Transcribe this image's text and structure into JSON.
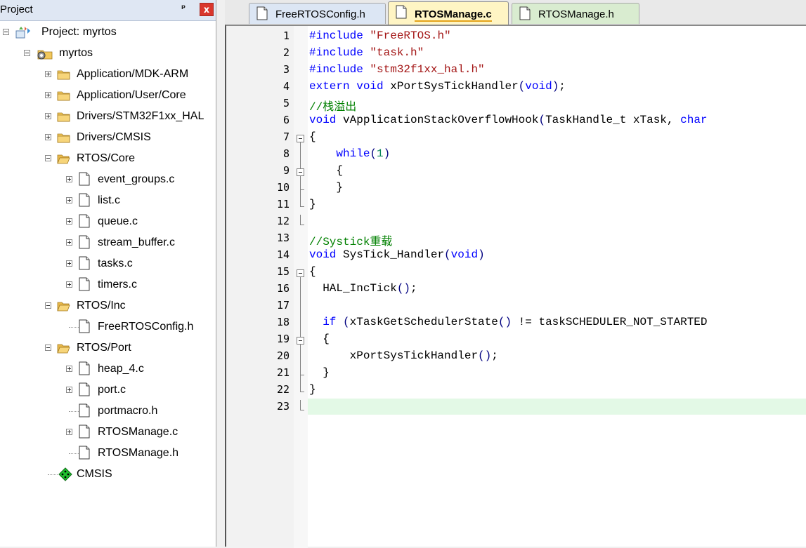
{
  "panel": {
    "title": "Project",
    "pin": "ᵖ",
    "close": "x"
  },
  "tree": [
    {
      "label": "Project: myrtos",
      "type": "project",
      "depth": 0,
      "expander": "minus"
    },
    {
      "label": "myrtos",
      "type": "target",
      "depth": 1,
      "expander": "minus"
    },
    {
      "label": "Application/MDK-ARM",
      "type": "folder",
      "depth": 2,
      "expander": "plus"
    },
    {
      "label": "Application/User/Core",
      "type": "folder",
      "depth": 2,
      "expander": "plus"
    },
    {
      "label": "Drivers/STM32F1xx_HAL",
      "type": "folder",
      "depth": 2,
      "expander": "plus"
    },
    {
      "label": "Drivers/CMSIS",
      "type": "folder",
      "depth": 2,
      "expander": "plus"
    },
    {
      "label": "RTOS/Core",
      "type": "folder-open",
      "depth": 2,
      "expander": "minus"
    },
    {
      "label": "event_groups.c",
      "type": "file",
      "depth": 3,
      "expander": "plus"
    },
    {
      "label": "list.c",
      "type": "file",
      "depth": 3,
      "expander": "plus"
    },
    {
      "label": "queue.c",
      "type": "file",
      "depth": 3,
      "expander": "plus"
    },
    {
      "label": "stream_buffer.c",
      "type": "file",
      "depth": 3,
      "expander": "plus"
    },
    {
      "label": "tasks.c",
      "type": "file",
      "depth": 3,
      "expander": "plus"
    },
    {
      "label": "timers.c",
      "type": "file",
      "depth": 3,
      "expander": "plus"
    },
    {
      "label": "RTOS/Inc",
      "type": "folder-open",
      "depth": 2,
      "expander": "minus"
    },
    {
      "label": "FreeRTOSConfig.h",
      "type": "file",
      "depth": 3,
      "expander": "none"
    },
    {
      "label": "RTOS/Port",
      "type": "folder-open",
      "depth": 2,
      "expander": "minus"
    },
    {
      "label": "heap_4.c",
      "type": "file",
      "depth": 3,
      "expander": "plus"
    },
    {
      "label": "port.c",
      "type": "file",
      "depth": 3,
      "expander": "plus"
    },
    {
      "label": "portmacro.h",
      "type": "file",
      "depth": 3,
      "expander": "none"
    },
    {
      "label": "RTOSManage.c",
      "type": "file",
      "depth": 3,
      "expander": "plus"
    },
    {
      "label": "RTOSManage.h",
      "type": "file",
      "depth": 3,
      "expander": "none"
    },
    {
      "label": "CMSIS",
      "type": "cmsis",
      "depth": 2,
      "expander": "none"
    }
  ],
  "tabs": [
    {
      "label": "FreeRTOSConfig.h",
      "active": false,
      "color": "#dce6f4"
    },
    {
      "label": "RTOSManage.c",
      "active": true,
      "color": "#fff5c4"
    },
    {
      "label": "RTOSManage.h",
      "active": false,
      "color": "#d9ecd0"
    }
  ],
  "code": [
    [
      [
        "kw",
        "#include "
      ],
      [
        "str",
        "\"FreeRTOS.h\""
      ]
    ],
    [
      [
        "kw",
        "#include "
      ],
      [
        "str",
        "\"task.h\""
      ]
    ],
    [
      [
        "kw",
        "#include "
      ],
      [
        "str",
        "\"stm32f1xx_hal.h\""
      ]
    ],
    [
      [
        "kw",
        "extern "
      ],
      [
        "kw",
        "void "
      ],
      [
        "",
        "xPortSysTickHandler"
      ],
      [
        "paren",
        "("
      ],
      [
        "kw",
        "void"
      ],
      [
        "paren",
        ")"
      ],
      [
        "",
        ";"
      ]
    ],
    [
      [
        "cm",
        "//栈溢出"
      ]
    ],
    [
      [
        "kw",
        "void "
      ],
      [
        "",
        "vApplicationStackOverflowHook"
      ],
      [
        "paren",
        "("
      ],
      [
        "",
        "TaskHandle_t xTask, "
      ],
      [
        "kw",
        "char"
      ]
    ],
    [
      [
        "",
        "{"
      ]
    ],
    [
      [
        "",
        "    "
      ],
      [
        "kw",
        "while"
      ],
      [
        "paren",
        "("
      ],
      [
        "num",
        "1"
      ],
      [
        "paren",
        ")"
      ]
    ],
    [
      [
        "",
        "    {"
      ]
    ],
    [
      [
        "",
        "    }"
      ]
    ],
    [
      [
        "",
        "}"
      ]
    ],
    [
      [
        "",
        ""
      ]
    ],
    [
      [
        "cm",
        "//Systick重载"
      ]
    ],
    [
      [
        "kw",
        "void "
      ],
      [
        "",
        "SysTick_Handler"
      ],
      [
        "paren",
        "("
      ],
      [
        "kw",
        "void"
      ],
      [
        "paren",
        ")"
      ]
    ],
    [
      [
        "",
        "{"
      ]
    ],
    [
      [
        "",
        "  HAL_IncTick"
      ],
      [
        "paren",
        "()"
      ],
      [
        "",
        ";"
      ]
    ],
    [
      [
        "",
        ""
      ]
    ],
    [
      [
        "",
        "  "
      ],
      [
        "kw",
        "if "
      ],
      [
        "paren",
        "("
      ],
      [
        "",
        "xTaskGetSchedulerState"
      ],
      [
        "paren",
        "()"
      ],
      [
        "",
        " != taskSCHEDULER_NOT_STARTED"
      ]
    ],
    [
      [
        "",
        "  {"
      ]
    ],
    [
      [
        "",
        "      xPortSysTickHandler"
      ],
      [
        "paren",
        "()"
      ],
      [
        "",
        ";"
      ]
    ],
    [
      [
        "",
        "  }"
      ]
    ],
    [
      [
        "",
        "}"
      ]
    ],
    [
      [
        "",
        ""
      ]
    ]
  ],
  "line_numbers": [
    "1",
    "2",
    "3",
    "4",
    "5",
    "6",
    "7",
    "8",
    "9",
    "10",
    "11",
    "12",
    "13",
    "14",
    "15",
    "16",
    "17",
    "18",
    "19",
    "20",
    "21",
    "22",
    "23"
  ],
  "current_line": 23,
  "folds": [
    {
      "start": 7,
      "end": 11
    },
    {
      "start": 9,
      "end": 10
    },
    {
      "start": 15,
      "end": 22
    },
    {
      "start": 19,
      "end": 21
    }
  ]
}
